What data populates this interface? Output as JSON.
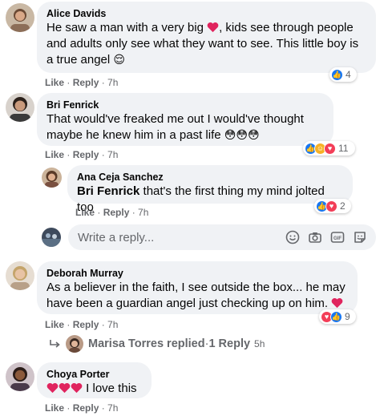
{
  "comments": [
    {
      "author": "Alice Davids",
      "text": "He saw a man with a very big ",
      "text2": ", kids see through people and adults only see what they want to see. This little boy is a true angel ",
      "emoji_end": "😌",
      "like": "Like",
      "reply": "Reply",
      "time": "7h",
      "reactions": "4"
    },
    {
      "author": "Bri Fenrick",
      "text": "That would've freaked me out I would've thought maybe he knew him in a past life ",
      "emoji_end": "😳😳😳",
      "like": "Like",
      "reply": "Reply",
      "time": "7h",
      "reactions": "11"
    },
    {
      "author": "Ana Ceja Sanchez",
      "mention": "Bri Fenrick",
      "text": " that's the first thing my mind jolted too",
      "like": "Like",
      "reply": "Reply",
      "time": "7h",
      "reactions": "2"
    },
    {
      "author": "Deborah Murray",
      "text": "As a believer in the faith, I see outside the box... he may have been a guardian angel just checking up on him. ",
      "like": "Like",
      "reply": "Reply",
      "time": "7h",
      "reactions": "9"
    },
    {
      "author": "Choya Porter",
      "text": " I love this",
      "like": "Like",
      "reply": "Reply",
      "time": "7h"
    }
  ],
  "reply_box": {
    "placeholder": "Write a reply..."
  },
  "replied": {
    "text": "Marisa Torres replied",
    "count": "1 Reply",
    "time": "5h"
  },
  "colors": {
    "like_blue": "#1877f2",
    "love_red": "#f33e58",
    "care_yellow": "#f7b125",
    "bubble": "#f0f2f5",
    "meta": "#65676b"
  },
  "icons": [
    "like-icon",
    "heart-icon",
    "care-icon",
    "smiley-icon",
    "camera-icon",
    "gif-icon",
    "sticker-icon",
    "reply-arrow-icon"
  ]
}
